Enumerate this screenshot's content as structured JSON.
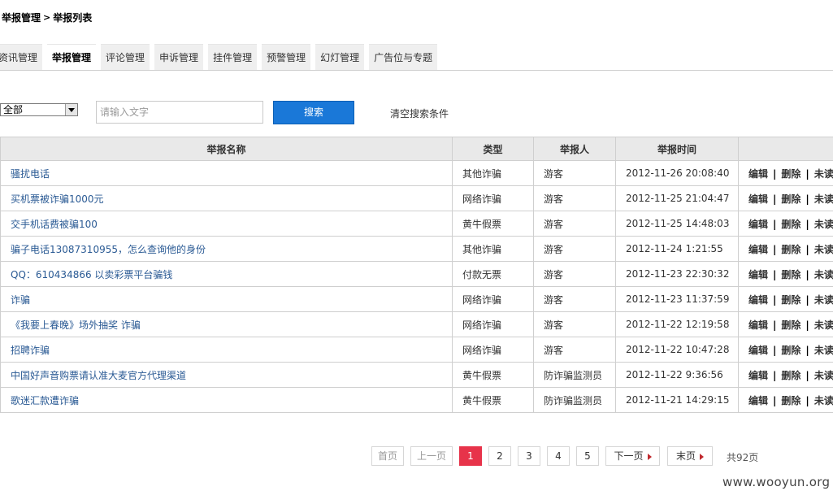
{
  "breadcrumb": {
    "parent": "举报管理",
    "separator": ">",
    "current": "举报列表"
  },
  "tabs": [
    {
      "label": "资讯管理",
      "active": false
    },
    {
      "label": "举报管理",
      "active": true
    },
    {
      "label": "评论管理",
      "active": false
    },
    {
      "label": "申诉管理",
      "active": false
    },
    {
      "label": "挂件管理",
      "active": false
    },
    {
      "label": "预警管理",
      "active": false
    },
    {
      "label": "幻灯管理",
      "active": false
    },
    {
      "label": "广告位与专题",
      "active": false
    }
  ],
  "filter": {
    "select_value": "全部",
    "search_placeholder": "请输入文字",
    "search_button": "搜索",
    "clear_link": "清空搜索条件"
  },
  "table": {
    "headers": [
      "举报名称",
      "类型",
      "举报人",
      "举报时间",
      ""
    ],
    "rows": [
      {
        "name": "骚扰电话",
        "type": "其他诈骗",
        "reporter": "游客",
        "time": "2012-11-26 20:08:40"
      },
      {
        "name": "买机票被诈骗1000元",
        "type": "网络诈骗",
        "reporter": "游客",
        "time": "2012-11-25 21:04:47"
      },
      {
        "name": "交手机话费被骗100",
        "type": "黄牛假票",
        "reporter": "游客",
        "time": "2012-11-25 14:48:03"
      },
      {
        "name": "骗子电话13087310955，怎么查询他的身份",
        "type": "其他诈骗",
        "reporter": "游客",
        "time": "2012-11-24 1:21:55"
      },
      {
        "name": "QQ：610434866 以卖彩票平台骗钱",
        "type": "付款无票",
        "reporter": "游客",
        "time": "2012-11-23 22:30:32"
      },
      {
        "name": "诈骗",
        "type": "网络诈骗",
        "reporter": "游客",
        "time": "2012-11-23 11:37:59"
      },
      {
        "name": "《我要上春晚》场外抽奖 诈骗",
        "type": "网络诈骗",
        "reporter": "游客",
        "time": "2012-11-22 12:19:58"
      },
      {
        "name": "招聘诈骗",
        "type": "网络诈骗",
        "reporter": "游客",
        "time": "2012-11-22 10:47:28"
      },
      {
        "name": "中国好声音购票请认准大麦官方代理渠道",
        "type": "黄牛假票",
        "reporter": "防诈骗监测员",
        "time": "2012-11-22 9:36:56"
      },
      {
        "name": "歌迷汇款遭诈骗",
        "type": "黄牛假票",
        "reporter": "防诈骗监测员",
        "time": "2012-11-21 14:29:15"
      }
    ],
    "actions": {
      "edit": "编辑",
      "delete": "删除",
      "third": "未读",
      "sep": "|"
    }
  },
  "pagination": {
    "first": "首页",
    "prev": "上一页",
    "pages": [
      "1",
      "2",
      "3",
      "4",
      "5"
    ],
    "current_page": "1",
    "next": "下一页",
    "last": "末页",
    "total": "共92页"
  },
  "watermark": "www.wooyun.org"
}
